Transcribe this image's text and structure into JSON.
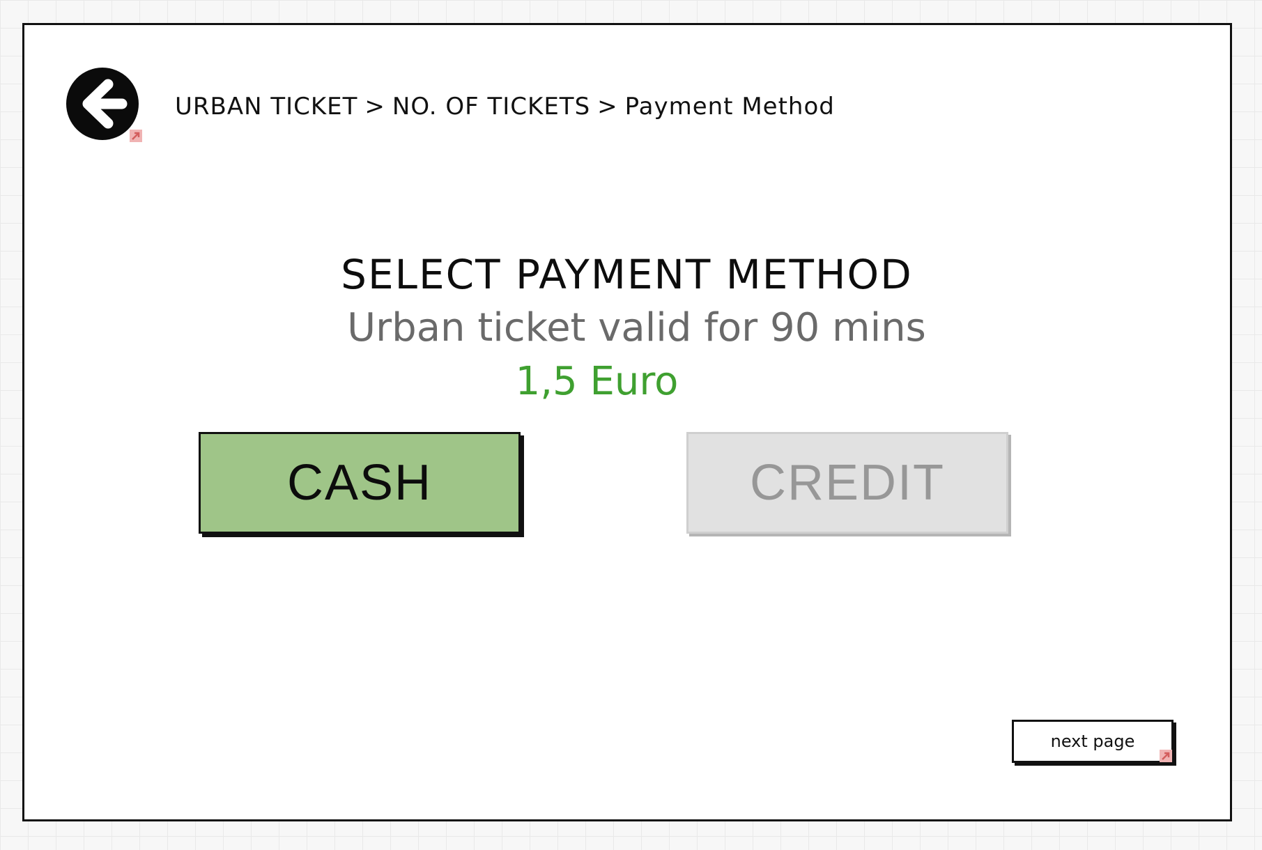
{
  "header": {
    "breadcrumb": [
      "URBAN TICKET",
      "NO. OF TICKETS",
      "Payment Method"
    ],
    "separator": ">"
  },
  "main": {
    "title": "SELECT PAYMENT METHOD",
    "subtitle": "Urban ticket valid for 90 mins",
    "price": "1,5 Euro",
    "cash_label": "CASH",
    "credit_label": "CREDIT"
  },
  "footer": {
    "next_label": "next page"
  },
  "icons": {
    "back": "arrow-left-circle-icon",
    "link": "link-arrow-icon"
  },
  "colors": {
    "cash_bg": "#9fc588",
    "credit_bg": "#e1e1e1",
    "credit_text": "#979797",
    "price": "#3fa030",
    "subtitle": "#6a6a6a",
    "link_marker": "#e8898a"
  }
}
